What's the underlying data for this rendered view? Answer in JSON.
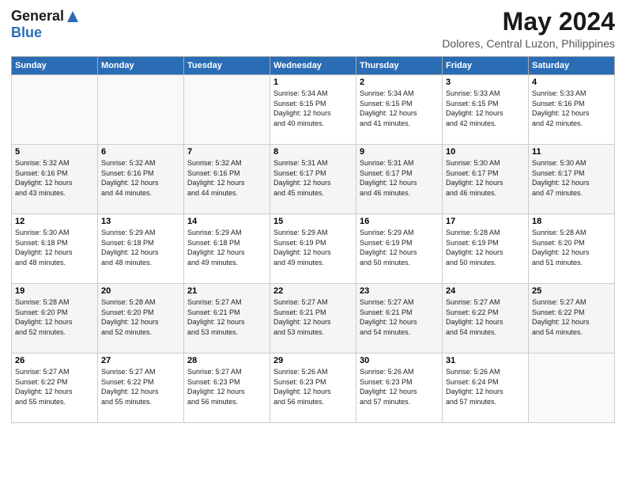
{
  "app": {
    "logo_general": "General",
    "logo_blue": "Blue",
    "month_title": "May 2024",
    "location": "Dolores, Central Luzon, Philippines"
  },
  "calendar": {
    "headers": [
      "Sunday",
      "Monday",
      "Tuesday",
      "Wednesday",
      "Thursday",
      "Friday",
      "Saturday"
    ],
    "weeks": [
      [
        {
          "day": "",
          "info": ""
        },
        {
          "day": "",
          "info": ""
        },
        {
          "day": "",
          "info": ""
        },
        {
          "day": "1",
          "info": "Sunrise: 5:34 AM\nSunset: 6:15 PM\nDaylight: 12 hours\nand 40 minutes."
        },
        {
          "day": "2",
          "info": "Sunrise: 5:34 AM\nSunset: 6:15 PM\nDaylight: 12 hours\nand 41 minutes."
        },
        {
          "day": "3",
          "info": "Sunrise: 5:33 AM\nSunset: 6:15 PM\nDaylight: 12 hours\nand 42 minutes."
        },
        {
          "day": "4",
          "info": "Sunrise: 5:33 AM\nSunset: 6:16 PM\nDaylight: 12 hours\nand 42 minutes."
        }
      ],
      [
        {
          "day": "5",
          "info": "Sunrise: 5:32 AM\nSunset: 6:16 PM\nDaylight: 12 hours\nand 43 minutes."
        },
        {
          "day": "6",
          "info": "Sunrise: 5:32 AM\nSunset: 6:16 PM\nDaylight: 12 hours\nand 44 minutes."
        },
        {
          "day": "7",
          "info": "Sunrise: 5:32 AM\nSunset: 6:16 PM\nDaylight: 12 hours\nand 44 minutes."
        },
        {
          "day": "8",
          "info": "Sunrise: 5:31 AM\nSunset: 6:17 PM\nDaylight: 12 hours\nand 45 minutes."
        },
        {
          "day": "9",
          "info": "Sunrise: 5:31 AM\nSunset: 6:17 PM\nDaylight: 12 hours\nand 46 minutes."
        },
        {
          "day": "10",
          "info": "Sunrise: 5:30 AM\nSunset: 6:17 PM\nDaylight: 12 hours\nand 46 minutes."
        },
        {
          "day": "11",
          "info": "Sunrise: 5:30 AM\nSunset: 6:17 PM\nDaylight: 12 hours\nand 47 minutes."
        }
      ],
      [
        {
          "day": "12",
          "info": "Sunrise: 5:30 AM\nSunset: 6:18 PM\nDaylight: 12 hours\nand 48 minutes."
        },
        {
          "day": "13",
          "info": "Sunrise: 5:29 AM\nSunset: 6:18 PM\nDaylight: 12 hours\nand 48 minutes."
        },
        {
          "day": "14",
          "info": "Sunrise: 5:29 AM\nSunset: 6:18 PM\nDaylight: 12 hours\nand 49 minutes."
        },
        {
          "day": "15",
          "info": "Sunrise: 5:29 AM\nSunset: 6:19 PM\nDaylight: 12 hours\nand 49 minutes."
        },
        {
          "day": "16",
          "info": "Sunrise: 5:29 AM\nSunset: 6:19 PM\nDaylight: 12 hours\nand 50 minutes."
        },
        {
          "day": "17",
          "info": "Sunrise: 5:28 AM\nSunset: 6:19 PM\nDaylight: 12 hours\nand 50 minutes."
        },
        {
          "day": "18",
          "info": "Sunrise: 5:28 AM\nSunset: 6:20 PM\nDaylight: 12 hours\nand 51 minutes."
        }
      ],
      [
        {
          "day": "19",
          "info": "Sunrise: 5:28 AM\nSunset: 6:20 PM\nDaylight: 12 hours\nand 52 minutes."
        },
        {
          "day": "20",
          "info": "Sunrise: 5:28 AM\nSunset: 6:20 PM\nDaylight: 12 hours\nand 52 minutes."
        },
        {
          "day": "21",
          "info": "Sunrise: 5:27 AM\nSunset: 6:21 PM\nDaylight: 12 hours\nand 53 minutes."
        },
        {
          "day": "22",
          "info": "Sunrise: 5:27 AM\nSunset: 6:21 PM\nDaylight: 12 hours\nand 53 minutes."
        },
        {
          "day": "23",
          "info": "Sunrise: 5:27 AM\nSunset: 6:21 PM\nDaylight: 12 hours\nand 54 minutes."
        },
        {
          "day": "24",
          "info": "Sunrise: 5:27 AM\nSunset: 6:22 PM\nDaylight: 12 hours\nand 54 minutes."
        },
        {
          "day": "25",
          "info": "Sunrise: 5:27 AM\nSunset: 6:22 PM\nDaylight: 12 hours\nand 54 minutes."
        }
      ],
      [
        {
          "day": "26",
          "info": "Sunrise: 5:27 AM\nSunset: 6:22 PM\nDaylight: 12 hours\nand 55 minutes."
        },
        {
          "day": "27",
          "info": "Sunrise: 5:27 AM\nSunset: 6:22 PM\nDaylight: 12 hours\nand 55 minutes."
        },
        {
          "day": "28",
          "info": "Sunrise: 5:27 AM\nSunset: 6:23 PM\nDaylight: 12 hours\nand 56 minutes."
        },
        {
          "day": "29",
          "info": "Sunrise: 5:26 AM\nSunset: 6:23 PM\nDaylight: 12 hours\nand 56 minutes."
        },
        {
          "day": "30",
          "info": "Sunrise: 5:26 AM\nSunset: 6:23 PM\nDaylight: 12 hours\nand 57 minutes."
        },
        {
          "day": "31",
          "info": "Sunrise: 5:26 AM\nSunset: 6:24 PM\nDaylight: 12 hours\nand 57 minutes."
        },
        {
          "day": "",
          "info": ""
        }
      ]
    ]
  }
}
